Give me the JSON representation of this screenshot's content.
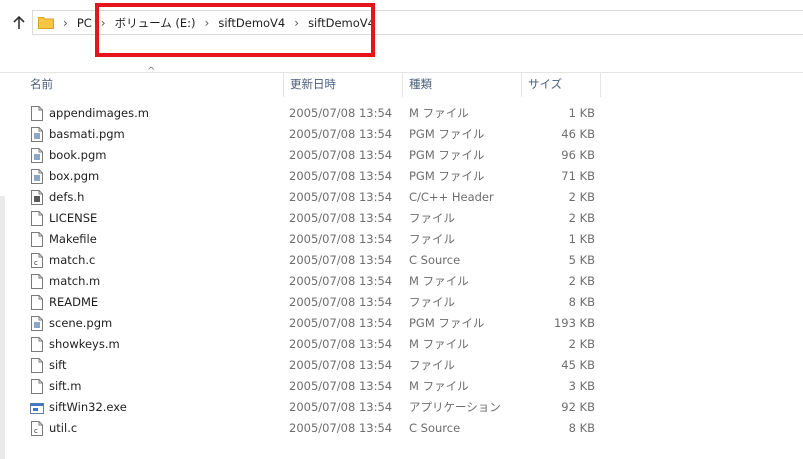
{
  "address": {
    "root": "PC",
    "crumbs": [
      "ボリューム (E:)",
      "siftDemoV4",
      "siftDemoV4"
    ]
  },
  "columns": {
    "name": "名前",
    "date": "更新日時",
    "type": "種類",
    "size": "サイズ"
  },
  "files": [
    {
      "name": "appendimages.m",
      "date": "2005/07/08 13:54",
      "type": "M ファイル",
      "size": "1 KB",
      "icon": "file-icon"
    },
    {
      "name": "basmati.pgm",
      "date": "2005/07/08 13:54",
      "type": "PGM ファイル",
      "size": "46 KB",
      "icon": "image-file-icon"
    },
    {
      "name": "book.pgm",
      "date": "2005/07/08 13:54",
      "type": "PGM ファイル",
      "size": "96 KB",
      "icon": "image-file-icon"
    },
    {
      "name": "box.pgm",
      "date": "2005/07/08 13:54",
      "type": "PGM ファイル",
      "size": "71 KB",
      "icon": "image-file-icon"
    },
    {
      "name": "defs.h",
      "date": "2005/07/08 13:54",
      "type": "C/C++ Header",
      "size": "2 KB",
      "icon": "header-file-icon"
    },
    {
      "name": "LICENSE",
      "date": "2005/07/08 13:54",
      "type": "ファイル",
      "size": "2 KB",
      "icon": "file-icon"
    },
    {
      "name": "Makefile",
      "date": "2005/07/08 13:54",
      "type": "ファイル",
      "size": "1 KB",
      "icon": "file-icon"
    },
    {
      "name": "match.c",
      "date": "2005/07/08 13:54",
      "type": "C Source",
      "size": "5 KB",
      "icon": "c-source-file-icon"
    },
    {
      "name": "match.m",
      "date": "2005/07/08 13:54",
      "type": "M ファイル",
      "size": "2 KB",
      "icon": "file-icon"
    },
    {
      "name": "README",
      "date": "2005/07/08 13:54",
      "type": "ファイル",
      "size": "8 KB",
      "icon": "file-icon"
    },
    {
      "name": "scene.pgm",
      "date": "2005/07/08 13:54",
      "type": "PGM ファイル",
      "size": "193 KB",
      "icon": "image-file-icon"
    },
    {
      "name": "showkeys.m",
      "date": "2005/07/08 13:54",
      "type": "M ファイル",
      "size": "2 KB",
      "icon": "file-icon"
    },
    {
      "name": "sift",
      "date": "2005/07/08 13:54",
      "type": "ファイル",
      "size": "45 KB",
      "icon": "file-icon"
    },
    {
      "name": "sift.m",
      "date": "2005/07/08 13:54",
      "type": "M ファイル",
      "size": "3 KB",
      "icon": "file-icon"
    },
    {
      "name": "siftWin32.exe",
      "date": "2005/07/08 13:54",
      "type": "アプリケーション",
      "size": "92 KB",
      "icon": "application-icon"
    },
    {
      "name": "util.c",
      "date": "2005/07/08 13:54",
      "type": "C Source",
      "size": "8 KB",
      "icon": "c-source-file-icon"
    }
  ],
  "colors": {
    "highlight": "#e8141b",
    "header_text": "#4c607a",
    "folder": "#f6c745"
  }
}
